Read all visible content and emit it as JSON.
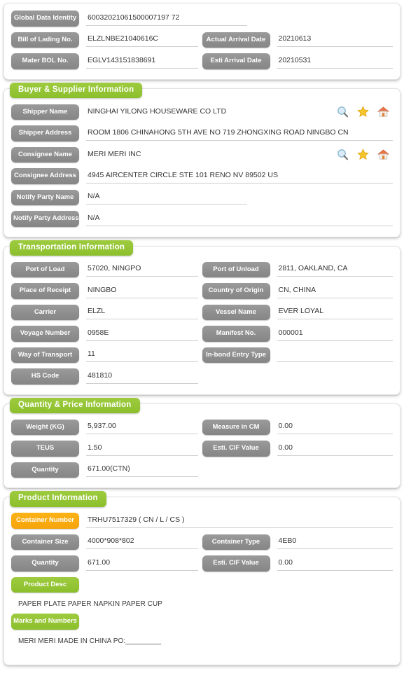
{
  "header_card": {
    "rows": [
      {
        "label": "Global Data Identity",
        "value": "60032021061500007197 72"
      },
      {
        "label": "Bill of Lading No.",
        "value": "ELZLNBE21040616C",
        "label2": "Actual Arrival Date",
        "value2": "20210613"
      },
      {
        "label": "Mater BOL No.",
        "value": "EGLV143151838691",
        "label2": "Esti Arrival Date",
        "value2": "20210531"
      }
    ],
    "gdi_value": "60032021061500007197 72"
  },
  "buyer_supplier": {
    "title": "Buyer & Supplier Information",
    "shipper_name_label": "Shipper Name",
    "shipper_name_value": "NINGHAI YILONG HOUSEWARE CO LTD",
    "shipper_address_label": "Shipper Address",
    "shipper_address_value": "ROOM 1806 CHINAHONG 5TH AVE NO 719 ZHONGXING ROAD NINGBO CN",
    "consignee_name_label": "Consignee Name",
    "consignee_name_value": "MERI MERI INC",
    "consignee_address_label": "Consignee Address",
    "consignee_address_value": "4945 AIRCENTER CIRCLE STE 101 RENO NV 89502 US",
    "notify_party_name_label": "Notify Party Name",
    "notify_party_name_value": "N/A",
    "notify_party_address_label": "Notify Party Address",
    "notify_party_address_value": "N/A",
    "icons": {
      "search": "search-icon",
      "star": "star-icon",
      "home": "home-icon"
    }
  },
  "transportation": {
    "title": "Transportation Information",
    "port_of_load_label": "Port of Load",
    "port_of_load_value": "57020, NINGPO",
    "port_of_unload_label": "Port of Unload",
    "port_of_unload_value": "2811, OAKLAND, CA",
    "place_of_receipt_label": "Place of Receipt",
    "place_of_receipt_value": "NINGBO",
    "country_of_origin_label": "Country of Origin",
    "country_of_origin_value": "CN, CHINA",
    "carrier_label": "Carrier",
    "carrier_value": "ELZL",
    "vessel_name_label": "Vessel Name",
    "vessel_name_value": "EVER LOYAL",
    "voyage_number_label": "Voyage Number",
    "voyage_number_value": "0958E",
    "manifest_no_label": "Manifest No.",
    "manifest_no_value": "000001",
    "way_of_transport_label": "Way of Transport",
    "way_of_transport_value": "11",
    "inbond_entry_type_label": "In-bond Entry Type",
    "inbond_entry_type_value": "",
    "hs_code_label": "HS Code",
    "hs_code_value": "481810"
  },
  "quantity_price": {
    "title": "Quantity & Price Information",
    "weight_label": "Weight (KG)",
    "weight_value": "5,937.00",
    "measure_label": "Measure in CM",
    "measure_value": "0.00",
    "teus_label": "TEUS",
    "teus_value": "1.50",
    "cif_label": "Esti. CIF Value",
    "cif_value": "0.00",
    "quantity_label": "Quantity",
    "quantity_value": "671.00(CTN)"
  },
  "product": {
    "title": "Product Information",
    "container_number_label": "Container Number",
    "container_number_value": "TRHU7517329 ( CN / L / CS )",
    "container_size_label": "Container Size",
    "container_size_value": "4000*908*802",
    "container_type_label": "Container Type",
    "container_type_value": "4EB0",
    "quantity_label": "Quantity",
    "quantity_value": "671.00",
    "cif_label": "Esti. CIF Value",
    "cif_value": "0.00",
    "product_desc_label": "Product Desc",
    "product_desc_value": "PAPER PLATE PAPER NAPKIN PAPER CUP",
    "marks_numbers_label": "Marks and Numbers",
    "marks_numbers_value": "MERI MERI MADE IN CHINA PO:_________"
  },
  "colors": {
    "green": "#8cbf2c",
    "gray": "#8e8e8e",
    "orange": "#f6a50b",
    "underline": "#cfcfcf"
  }
}
